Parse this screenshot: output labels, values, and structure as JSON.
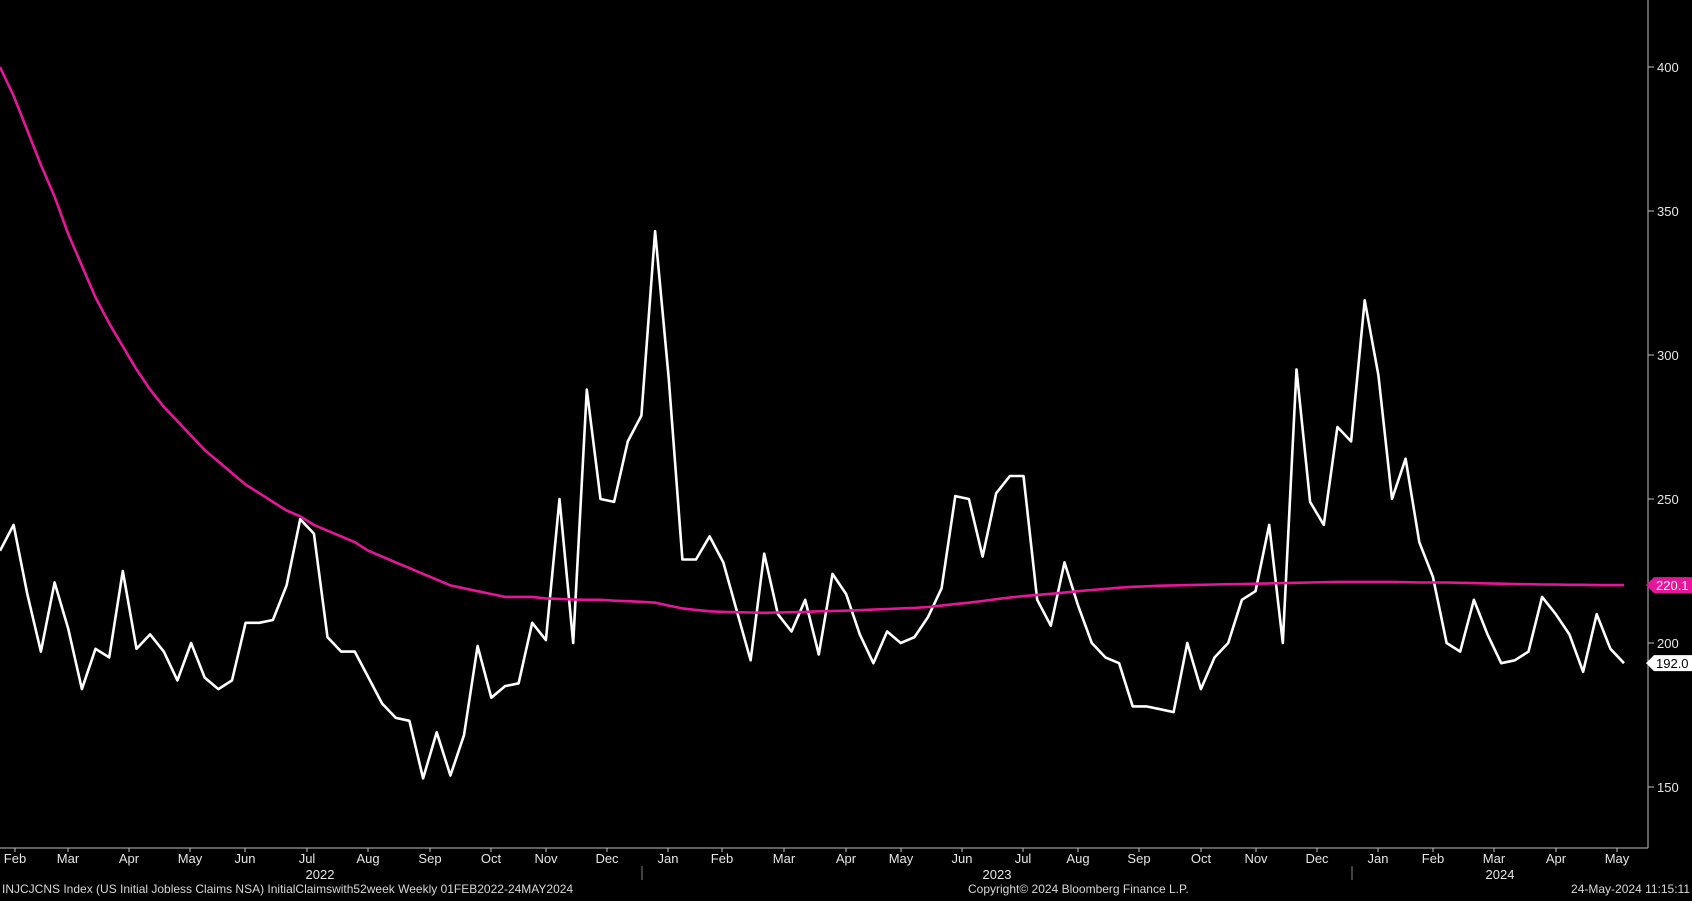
{
  "chart_data": {
    "type": "line",
    "title": "INJCJCNS Index (US Initial Jobless Claims NSA) InitialClaimswith52week  Weekly 01FEB2022-24MAY2024",
    "ylim": [
      125,
      420
    ],
    "y_ticks": [
      150,
      200,
      250,
      300,
      350,
      400
    ],
    "grid": false,
    "x_month_labels": [
      "Feb",
      "Mar",
      "Apr",
      "May",
      "Jun",
      "Jul",
      "Aug",
      "Sep",
      "Oct",
      "Nov",
      "Dec",
      "Jan",
      "Feb",
      "Mar",
      "Apr",
      "May",
      "Jun",
      "Jul",
      "Aug",
      "Sep",
      "Oct",
      "Nov",
      "Dec",
      "Jan",
      "Feb",
      "Mar",
      "Apr",
      "May"
    ],
    "x_year_labels": [
      "2022",
      "2023",
      "2024"
    ],
    "series": [
      {
        "color": "#ffffff",
        "values": [
          232,
          241,
          217,
          197,
          221,
          205,
          184,
          198,
          195,
          225,
          198,
          203,
          197,
          187,
          200,
          188,
          184,
          187,
          207,
          207,
          208,
          220,
          243,
          238,
          202,
          197,
          197,
          188,
          179,
          174,
          173,
          153,
          169,
          154,
          168,
          199,
          181,
          185,
          186,
          207,
          201,
          250,
          200,
          288,
          250,
          249,
          270,
          279,
          343,
          292,
          229,
          229,
          237,
          228,
          211,
          194,
          231,
          210,
          204,
          215,
          196,
          224,
          217,
          203,
          193,
          204,
          200,
          202,
          209,
          219,
          251,
          250,
          230,
          252,
          258,
          258,
          215,
          206,
          228,
          213,
          200,
          195,
          193,
          178,
          178,
          177,
          176,
          200,
          184,
          195,
          200,
          215,
          218,
          241,
          200,
          295,
          249,
          241,
          275,
          270,
          319,
          293,
          250,
          264,
          235,
          223,
          200,
          197,
          215,
          203,
          193,
          194,
          197,
          216,
          210,
          203,
          190,
          210,
          198,
          193
        ]
      },
      {
        "color": "#e6159a",
        "last_value_label": "220.1",
        "values": [
          400,
          390,
          378,
          366,
          355,
          342,
          331,
          320,
          311,
          303,
          295,
          288,
          282,
          277,
          272,
          267,
          263,
          259,
          255,
          252,
          249,
          246,
          244,
          241,
          239,
          237,
          235,
          232,
          230,
          228,
          226,
          224,
          222,
          220,
          219,
          218,
          217,
          216,
          216,
          216,
          215.5,
          215.3,
          215.1,
          215,
          215,
          214.7,
          214.5,
          214.3,
          214,
          213,
          212,
          211.5,
          211,
          210.8,
          210.7,
          210.6,
          210.5,
          210.6,
          210.7,
          210.8,
          211,
          211.1,
          211.2,
          211.4,
          211.6,
          211.8,
          212,
          212.2,
          212.5,
          213,
          213.5,
          214,
          214.6,
          215.2,
          215.8,
          216.3,
          216.7,
          217.1,
          217.5,
          218,
          218.4,
          218.8,
          219.2,
          219.5,
          219.7,
          219.9,
          220,
          220.1,
          220.2,
          220.3,
          220.4,
          220.5,
          220.6,
          220.7,
          220.8,
          220.9,
          221,
          221.1,
          221.2,
          221.2,
          221.2,
          221.2,
          221.2,
          221.1,
          221,
          221,
          221,
          220.9,
          220.8,
          220.7,
          220.6,
          220.5,
          220.4,
          220.3,
          220.3,
          220.2,
          220.2,
          220.1,
          220.1,
          220.1
        ]
      }
    ],
    "last_value_labels": [
      "220.1",
      "192.0"
    ]
  },
  "footer": {
    "left": "INJCJCNS Index (US Initial Jobless Claims NSA) InitialClaimswith52week  Weekly 01FEB2022-24MAY2024",
    "center": "Copyright© 2024 Bloomberg Finance L.P.",
    "right": "24-May-2024 11:15:11"
  },
  "colors": {
    "background": "#000000",
    "primary_line": "#ffffff",
    "average_line": "#e6159a",
    "axis": "#bfbfbf"
  }
}
